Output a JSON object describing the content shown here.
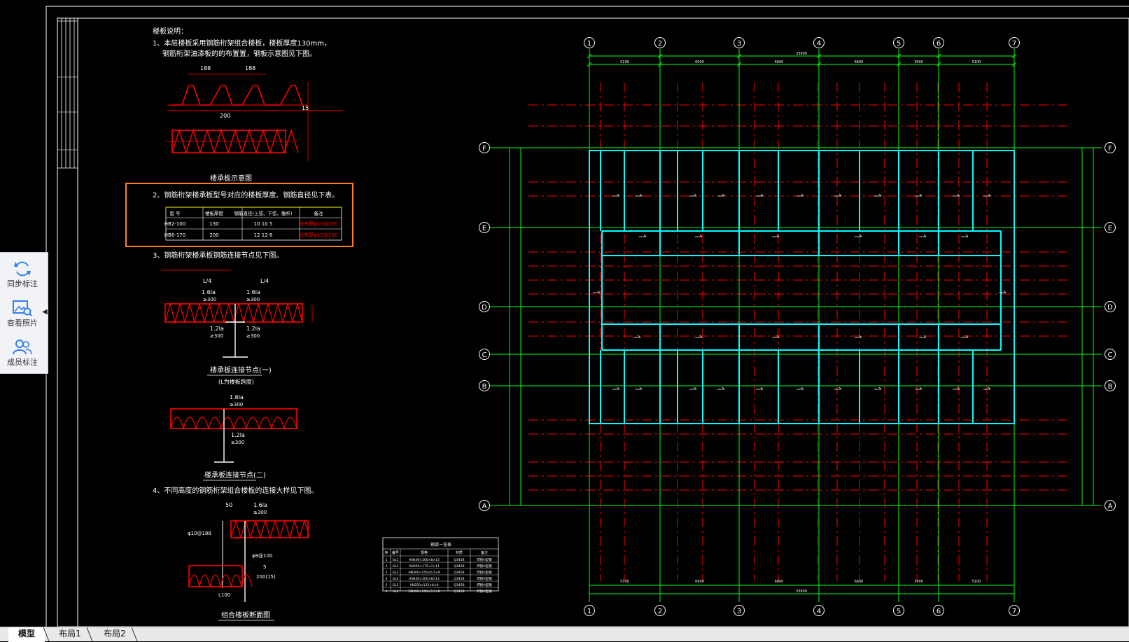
{
  "drawing": {
    "notes_title": "楼板说明：",
    "note1_line1": "1、本层楼板采用钢筋桁架组合楼板，楼板厚度130mm，",
    "note1_line2": "钢筋桁架油漆板的的布置置，钢板示意图见下图。",
    "note2": "2、钢筋桁架楼承板型号对应的楼板厚度、钢筋直径见下表。",
    "note3": "3、钢筋桁架楼承板钢筋连接节点见下图。",
    "note4": "4、不同高度的钢筋桁架组合楼板的连接大样见下图。",
    "section_caption": "楼承板示意图",
    "detail1_caption": "楼承板连接节点(一)",
    "detail1_sub": "(L为楼板跨度)",
    "detail2_caption": "楼承板连接节点(二)",
    "detail3_caption": "组合楼板断面图",
    "dim_labels": [
      "188",
      "188",
      "200",
      "50",
      "1.6la",
      "≥300",
      "1.2la",
      "L/4",
      "15",
      "5",
      "200(15)",
      "L100",
      "φ10@188",
      "φ8@100"
    ],
    "table": {
      "headers": [
        "型 号",
        "楼板厚度",
        "钢筋直径(上弦、下弦、腹杆)",
        "备注"
      ],
      "rows": [
        [
          "HB2-100",
          "130",
          "10   10   5",
          "分布筋φ10@200"
        ],
        [
          "HB6-170",
          "200",
          "12   12   6",
          "分布筋φ12@200"
        ]
      ]
    },
    "small_table": {
      "title": "钢梁一览表",
      "headers": [
        "序",
        "编号",
        "规格",
        "材质",
        "备注"
      ],
      "rows": [
        [
          "1",
          "GL1",
          "HN400×200×8×13",
          "Q345B",
          "焊接H型钢"
        ],
        [
          "2",
          "GL2",
          "HN350×175×7×11",
          "Q345B",
          "焊接H型钢"
        ],
        [
          "3",
          "GL3",
          "HN300×150×6.5×9",
          "Q345B",
          "焊接H型钢"
        ],
        [
          "4",
          "GL4",
          "HN400×200×8×13",
          "Q345B",
          "焊接H型钢"
        ],
        [
          "5",
          "GL5",
          "HN250×125×6×9",
          "Q345B",
          "焊接H型钢"
        ],
        [
          "6",
          "GL6",
          "HN200×100×5.5×8",
          "Q345B",
          "焊接H型钢"
        ]
      ]
    },
    "axis_numbers": [
      "1",
      "2",
      "3",
      "4",
      "5",
      "6",
      "7"
    ],
    "axis_letters": [
      "F",
      "E",
      "D",
      "C",
      "B",
      "A"
    ],
    "span_dims": [
      "5100",
      "6900",
      "6600",
      "6600",
      "3900",
      "5100"
    ],
    "total_dim": "33900",
    "colors": {
      "grid": "#00ff00",
      "beam": "#00ffff",
      "rebar": "#ff0000",
      "text": "#ffffff",
      "highlight": "#ff7f27",
      "dim": "#ffff00"
    }
  },
  "toolbar": {
    "sync": "同步标注",
    "photos": "查看照片",
    "members": "成员标注",
    "icons": [
      "refresh-icon",
      "image-search-icon",
      "members-icon"
    ]
  },
  "tabs": [
    "模型",
    "布局1",
    "布局2"
  ]
}
